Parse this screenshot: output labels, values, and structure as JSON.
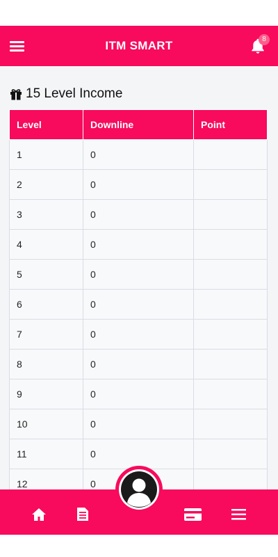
{
  "header": {
    "title": "ITM SMART",
    "notification_count": "8",
    "menu_icon": "hamburger-menu-icon",
    "bell_icon": "bell-icon"
  },
  "section": {
    "icon": "gift-icon",
    "title": "15 Level Income"
  },
  "table": {
    "columns": [
      "Level",
      "Downline",
      "Point"
    ],
    "rows": [
      [
        "1",
        "0",
        ""
      ],
      [
        "2",
        "0",
        ""
      ],
      [
        "3",
        "0",
        ""
      ],
      [
        "4",
        "0",
        ""
      ],
      [
        "5",
        "0",
        ""
      ],
      [
        "6",
        "0",
        ""
      ],
      [
        "7",
        "0",
        ""
      ],
      [
        "8",
        "0",
        ""
      ],
      [
        "9",
        "0",
        ""
      ],
      [
        "10",
        "0",
        ""
      ],
      [
        "11",
        "0",
        ""
      ],
      [
        "12",
        "0",
        ""
      ]
    ]
  },
  "bottom_nav": {
    "items": [
      "home-icon",
      "document-icon",
      "profile-icon",
      "card-icon",
      "menu-icon"
    ]
  },
  "colors": {
    "accent": "#f80a5c",
    "page_bg": "#f4f5f7",
    "badge": "#ff5d8c"
  }
}
